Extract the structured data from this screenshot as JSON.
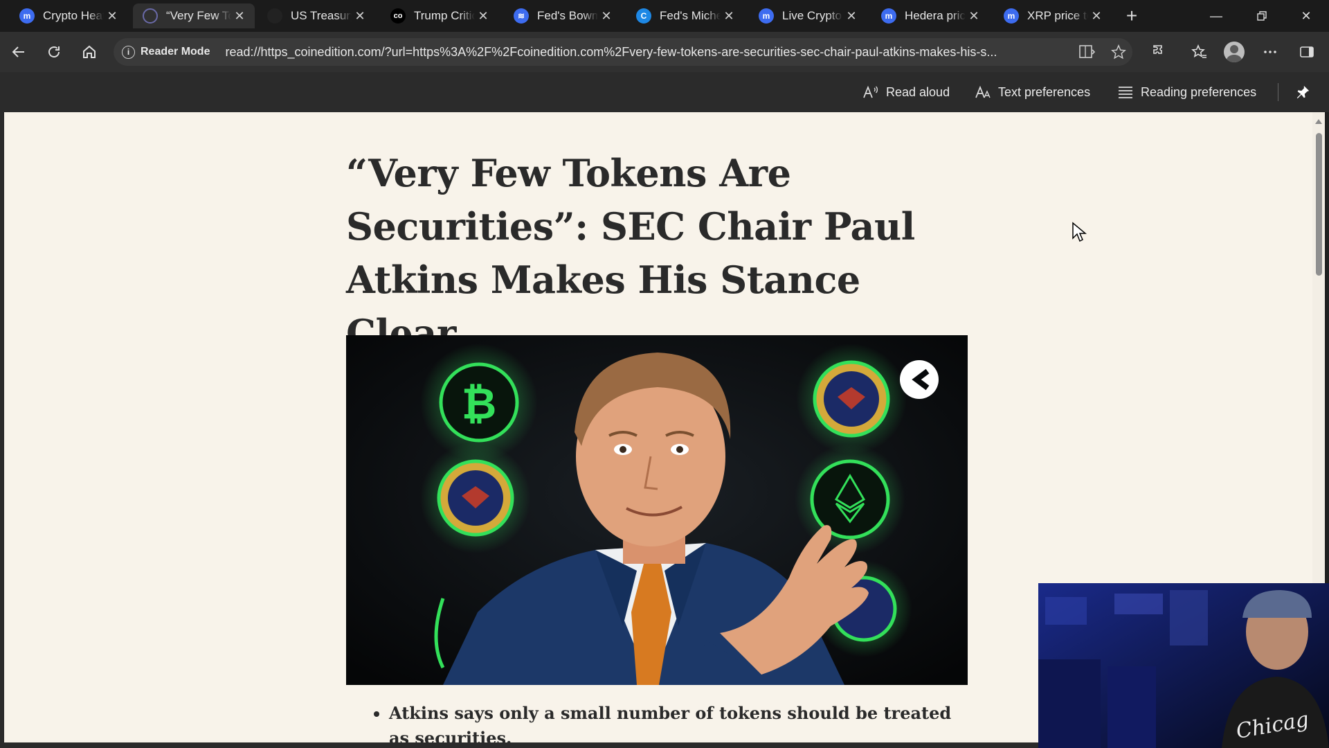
{
  "browser": {
    "tabs": [
      {
        "title": "Crypto Heat",
        "favicon": "coinmarketcap-icon",
        "color": "#3d6cf0",
        "active": false
      },
      {
        "title": "“Very Few To",
        "favicon": "coinedition-icon",
        "color": "#303030",
        "active": true
      },
      {
        "title": "US Treasury",
        "favicon": "blank-icon",
        "color": "#1b1b1b",
        "active": false
      },
      {
        "title": "Trump Critic",
        "favicon": "coindesk-icon",
        "color": "#000000",
        "active": false
      },
      {
        "title": "Fed's Bowm",
        "favicon": "site-icon",
        "color": "#3d6cf0",
        "active": false
      },
      {
        "title": "Fed's Michel",
        "favicon": "cointelegraph-icon",
        "color": "#1e88e5",
        "active": false
      },
      {
        "title": "Live Crypto",
        "favicon": "coinmarketcap-icon",
        "color": "#3d6cf0",
        "active": false
      },
      {
        "title": "Hedera pric",
        "favicon": "coinmarketcap-icon",
        "color": "#3d6cf0",
        "active": false
      },
      {
        "title": "XRP price to",
        "favicon": "coinmarketcap-icon",
        "color": "#3d6cf0",
        "active": false
      }
    ],
    "new_tab_label": "+",
    "address": {
      "reader_mode_label": "Reader Mode",
      "url": "read://https_coinedition.com/?url=https%3A%2F%2Fcoinedition.com%2Fvery-few-tokens-are-securities-sec-chair-paul-atkins-makes-his-s..."
    },
    "reader_toolbar": {
      "read_aloud": "Read aloud",
      "text_preferences": "Text preferences",
      "reading_preferences": "Reading preferences"
    }
  },
  "article": {
    "headline": "“Very Few Tokens Are Securities”: SEC Chair Paul Atkins Makes His Stance Clear",
    "bullets": [
      "Atkins says only a small number of tokens should be treated as securities."
    ]
  },
  "colors": {
    "reader_background": "#f8f3ea",
    "headline_color": "#2a2a2a",
    "accent_green": "#33e05a"
  }
}
